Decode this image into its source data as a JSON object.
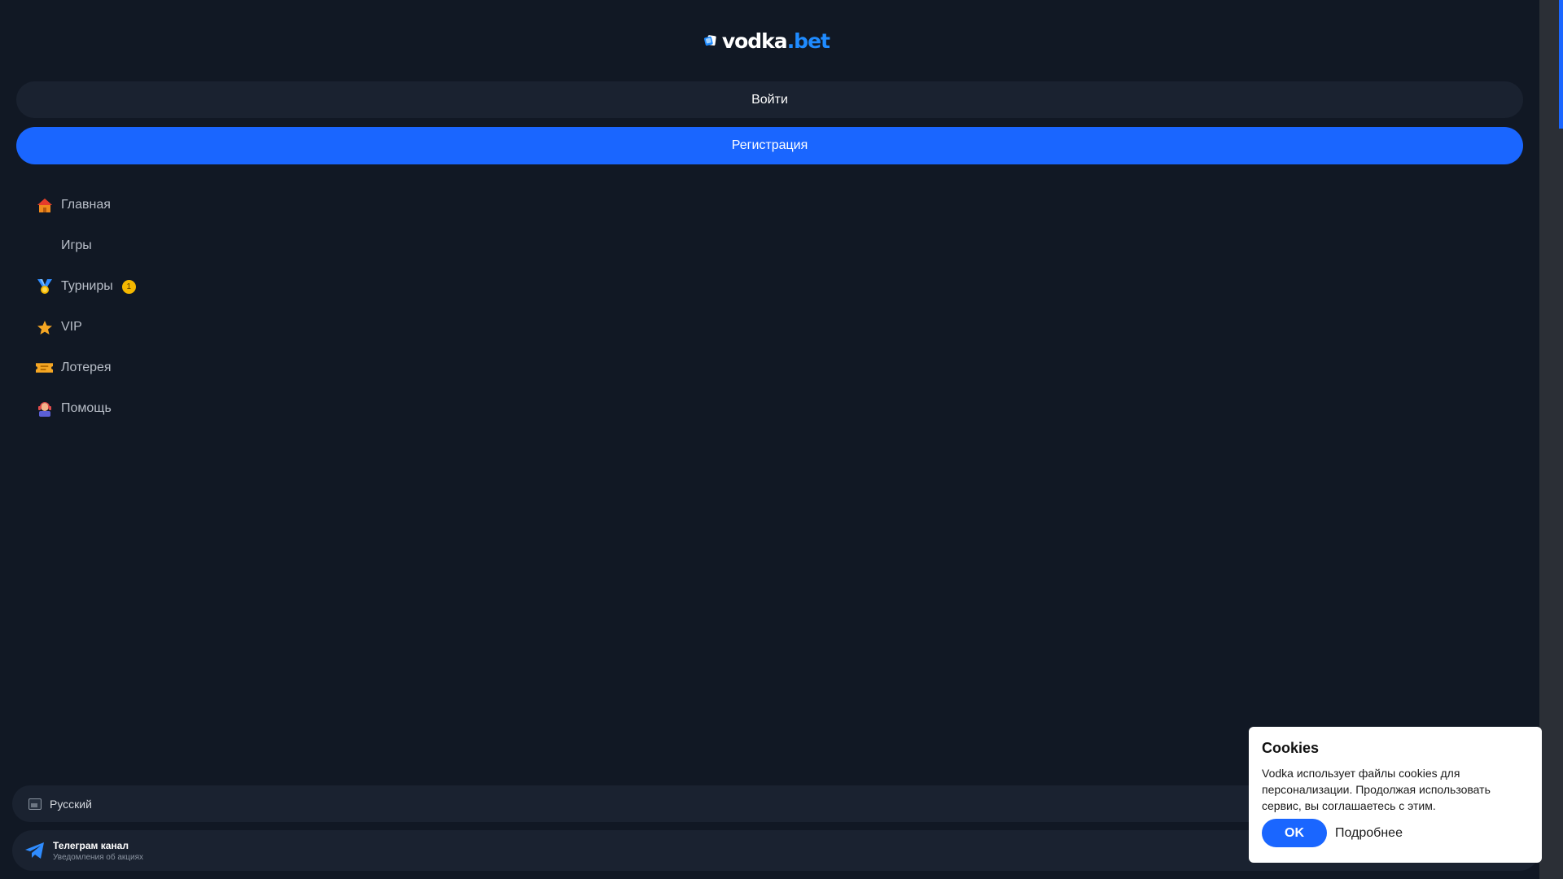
{
  "logo": {
    "brand_main": "vodka",
    "brand_accent": ".bet"
  },
  "auth": {
    "login_label": "Войти",
    "register_label": "Регистрация"
  },
  "nav": {
    "items": [
      {
        "label": "Главная",
        "icon": "home-icon"
      },
      {
        "label": "Игры",
        "icon": "games-icon"
      },
      {
        "label": "Турниры",
        "icon": "medal-icon",
        "badge": "1"
      },
      {
        "label": "VIP",
        "icon": "star-icon"
      },
      {
        "label": "Лотерея",
        "icon": "ticket-icon"
      },
      {
        "label": "Помощь",
        "icon": "support-agent-icon"
      }
    ]
  },
  "language": {
    "current": "Русский"
  },
  "telegram": {
    "title": "Телеграм канал",
    "subtitle": "Уведомления об акциях"
  },
  "cookie": {
    "title": "Cookies",
    "text": "Vodka использует файлы cookies для персонализации. Продолжая использовать сервис, вы соглашаетесь с этим.",
    "ok_label": "OK",
    "more_label": "Подробнее"
  },
  "colors": {
    "background": "#111824",
    "surface": "#1a2230",
    "accent": "#1a66ff",
    "brand_accent": "#1f8bff",
    "badge": "#f5b800"
  }
}
